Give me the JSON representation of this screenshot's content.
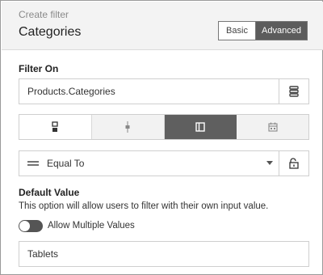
{
  "header": {
    "breadcrumb": "Create filter",
    "title": "Categories",
    "mode_basic": "Basic",
    "mode_advanced": "Advanced",
    "active_mode": "Advanced"
  },
  "filter_on": {
    "label": "Filter On",
    "value": "Products.Categories",
    "side_icon": "list-icon"
  },
  "view_types": {
    "items": [
      "single-value-icon",
      "range-slider-icon",
      "panel-icon",
      "calendar-icon"
    ],
    "active_index": 2
  },
  "operator": {
    "icon": "equals-icon",
    "value": "Equal To",
    "lock_icon": "unlock-icon"
  },
  "default_value": {
    "label": "Default Value",
    "description": "This option will allow users to filter with their own input value.",
    "toggle_label": "Allow Multiple Values",
    "toggle_on": false,
    "value": "Tablets"
  }
}
